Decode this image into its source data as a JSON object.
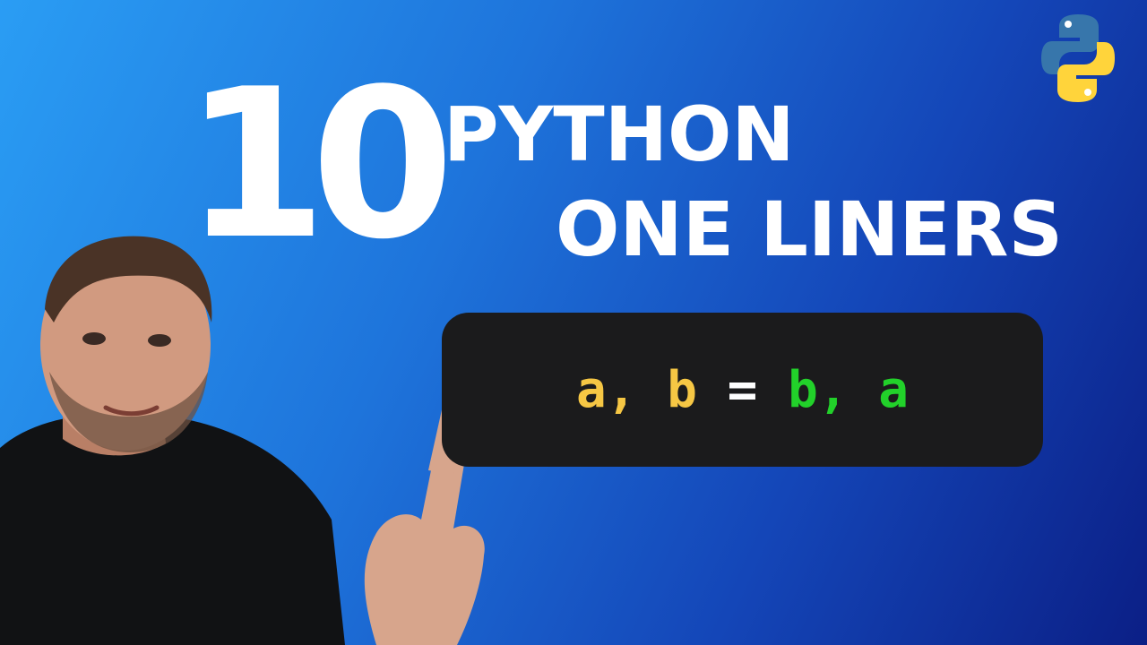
{
  "thumbnail": {
    "number": "10",
    "title_line1": "PYTHON",
    "title_line2": "ONE LINERS"
  },
  "code": {
    "tokens": [
      {
        "text": "a,",
        "color": "yellow"
      },
      {
        "text": " b",
        "color": "yellow"
      },
      {
        "text": " = ",
        "color": "white"
      },
      {
        "text": "b,",
        "color": "green"
      },
      {
        "text": " a",
        "color": "green"
      }
    ]
  },
  "colors": {
    "background_light": "#2a9df4",
    "background_dark": "#0b1f86",
    "code_box": "#1b1b1c",
    "code_yellow": "#f6c744",
    "code_green": "#22d12a",
    "python_blue": "#3776ab",
    "python_yellow": "#ffd43b"
  },
  "icons": {
    "logo": "python-logo-icon"
  }
}
